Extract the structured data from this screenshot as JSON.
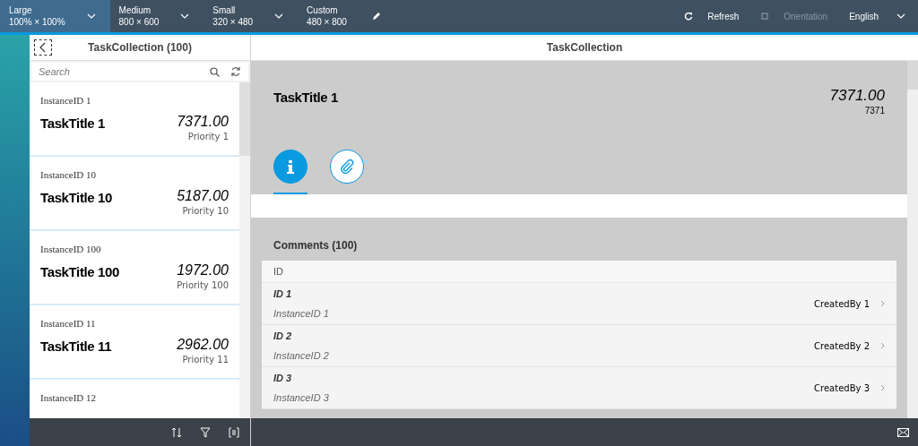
{
  "toolbar": {
    "devices": [
      {
        "label": "Large",
        "size": "100% × 100%",
        "selected": true,
        "dropdown": true
      },
      {
        "label": "Medium",
        "size": "800 × 600",
        "selected": false,
        "dropdown": true
      },
      {
        "label": "Small",
        "size": "320 × 480",
        "selected": false,
        "dropdown": true
      },
      {
        "label": "Custom",
        "size": "480 × 800",
        "selected": false,
        "dropdown": false
      }
    ],
    "refresh": "Refresh",
    "orientation": {
      "label": "Orientation",
      "disabled": true
    },
    "language": "English"
  },
  "master": {
    "title": "TaskCollection (100)",
    "search": {
      "placeholder": "Search"
    },
    "items": [
      {
        "instance_id": "InstanceID 1",
        "title": "TaskTitle 1",
        "amount": "7371.00",
        "priority": "Priority 1"
      },
      {
        "instance_id": "InstanceID 10",
        "title": "TaskTitle 10",
        "amount": "5187.00",
        "priority": "Priority 10"
      },
      {
        "instance_id": "InstanceID 100",
        "title": "TaskTitle 100",
        "amount": "1972.00",
        "priority": "Priority 100"
      },
      {
        "instance_id": "InstanceID 11",
        "title": "TaskTitle 11",
        "amount": "2962.00",
        "priority": "Priority 11"
      },
      {
        "instance_id": "InstanceID 12"
      }
    ]
  },
  "detail": {
    "title": "TaskCollection",
    "header": {
      "title": "TaskTitle 1",
      "amount": "7371.00",
      "amount_sub": "7371"
    },
    "tabs": [
      {
        "kind": "info",
        "selected": true
      },
      {
        "kind": "attachment",
        "selected": false
      }
    ],
    "comments": {
      "title": "Comments (100)",
      "column": "ID",
      "rows": [
        {
          "id": "ID 1",
          "instance_id": "InstanceID 1",
          "created_by": "CreatedBy 1"
        },
        {
          "id": "ID 2",
          "instance_id": "InstanceID 2",
          "created_by": "CreatedBy 2"
        },
        {
          "id": "ID 3",
          "instance_id": "InstanceID 3",
          "created_by": "CreatedBy 3"
        }
      ]
    }
  }
}
